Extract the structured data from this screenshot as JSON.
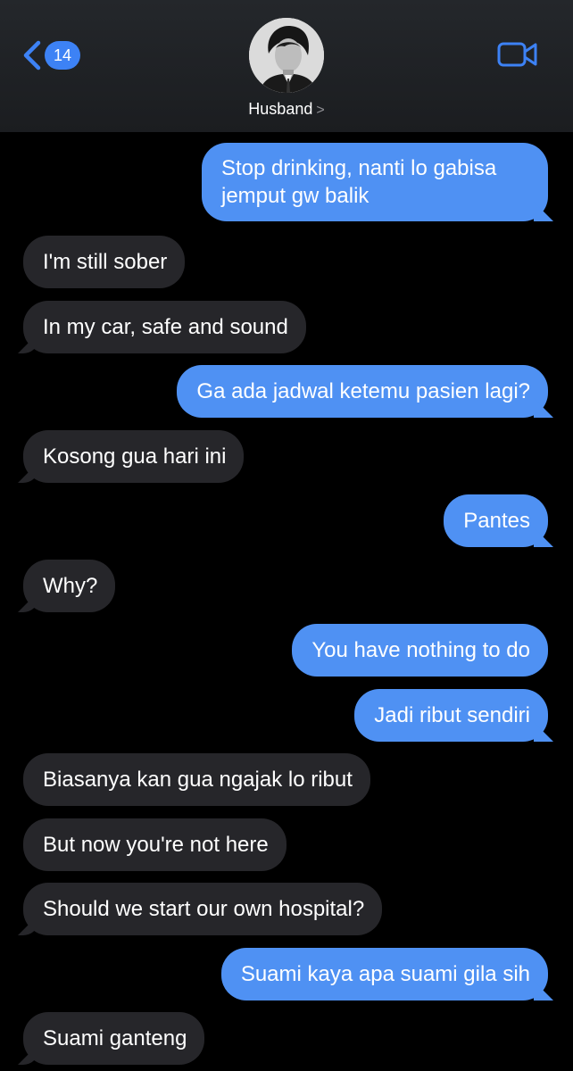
{
  "header": {
    "back_count": "14",
    "contact_name": "Husband",
    "contact_chevron": ">"
  },
  "colors": {
    "sent_bubble": "#4f91f3",
    "received_bubble": "#26262a",
    "accent": "#3d82f5",
    "background": "#000000"
  },
  "icons": {
    "back": "chevron-left-icon",
    "video": "video-camera-icon",
    "avatar": "contact-avatar"
  },
  "messages": [
    {
      "direction": "sent",
      "lines": [
        "Stop drinking, nanti lo gabisa",
        "jemput gw balik"
      ]
    },
    {
      "direction": "received",
      "lines": [
        "I'm still sober"
      ]
    },
    {
      "direction": "received",
      "lines": [
        "In my car, safe and sound"
      ]
    },
    {
      "direction": "sent",
      "lines": [
        "Ga ada jadwal ketemu pasien lagi?"
      ]
    },
    {
      "direction": "received",
      "lines": [
        "Kosong gua hari ini"
      ]
    },
    {
      "direction": "sent",
      "lines": [
        "Pantes"
      ]
    },
    {
      "direction": "received",
      "lines": [
        "Why?"
      ]
    },
    {
      "direction": "sent",
      "lines": [
        "You have nothing to do"
      ]
    },
    {
      "direction": "sent",
      "lines": [
        "Jadi ribut sendiri"
      ]
    },
    {
      "direction": "received",
      "lines": [
        "Biasanya kan gua ngajak lo ribut"
      ]
    },
    {
      "direction": "received",
      "lines": [
        "But now you're not here"
      ]
    },
    {
      "direction": "received",
      "lines": [
        "Should we start our own hospital?"
      ]
    },
    {
      "direction": "sent",
      "lines": [
        "Suami kaya apa suami gila sih"
      ]
    },
    {
      "direction": "received",
      "lines": [
        "Suami ganteng"
      ]
    }
  ]
}
